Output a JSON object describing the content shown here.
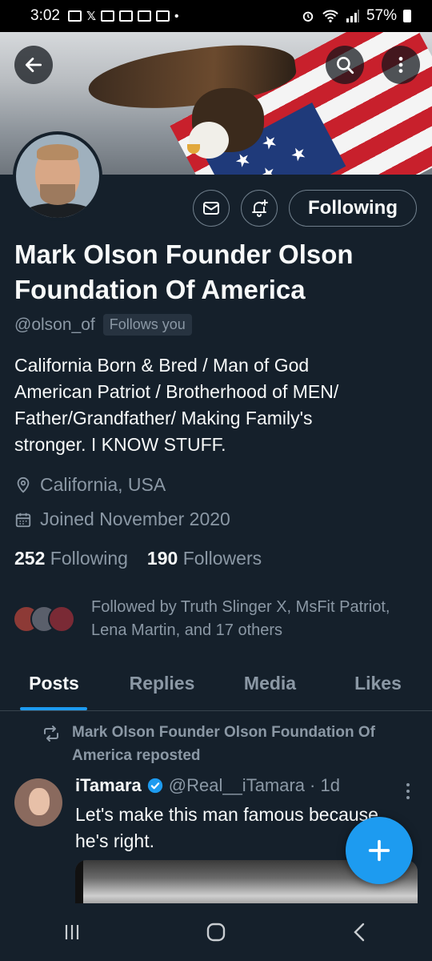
{
  "status_bar": {
    "time": "3:02",
    "battery": "57%"
  },
  "profile": {
    "name": "Mark Olson Founder Olson Foundation Of America",
    "handle": "@olson_of",
    "follows_you_badge": "Follows you",
    "bio_lines": [
      "California Born & Bred / Man of God",
      "American Patriot / Brotherhood of MEN/",
      "Father/Grandfather/ Making Family's",
      "stronger. I KNOW STUFF."
    ],
    "location": "California, USA",
    "joined": "Joined November 2020",
    "following_count": "252",
    "following_label": "Following",
    "followers_count": "190",
    "followers_label": "Followers",
    "followed_by_line1": "Followed by Truth Slinger X, MsFit Patriot,",
    "followed_by_line2": "Lena Martin, and 17 others"
  },
  "actions": {
    "following_button": "Following"
  },
  "tabs": [
    {
      "label": "Posts",
      "active": true
    },
    {
      "label": "Replies",
      "active": false
    },
    {
      "label": "Media",
      "active": false
    },
    {
      "label": "Likes",
      "active": false
    }
  ],
  "post": {
    "repost_line1": "Mark Olson Founder Olson Foundation Of",
    "repost_line2": "America reposted",
    "author": "iTamara",
    "author_handle": "@Real__iTamara",
    "time": "· 1d",
    "text_line1": "Let's make this man famous because",
    "text_line2": "he's right."
  },
  "colors": {
    "background": "#15202b",
    "accent": "#1d9bf0",
    "muted": "#8b98a5",
    "text": "#f7f9f9"
  },
  "icons": [
    "back-arrow-icon",
    "search-icon",
    "more-vertical-icon",
    "mail-icon",
    "bell-plus-icon",
    "location-pin-icon",
    "calendar-icon",
    "repost-icon",
    "verified-badge-icon",
    "compose-plus-icon",
    "recents-icon",
    "home-icon",
    "back-icon"
  ]
}
